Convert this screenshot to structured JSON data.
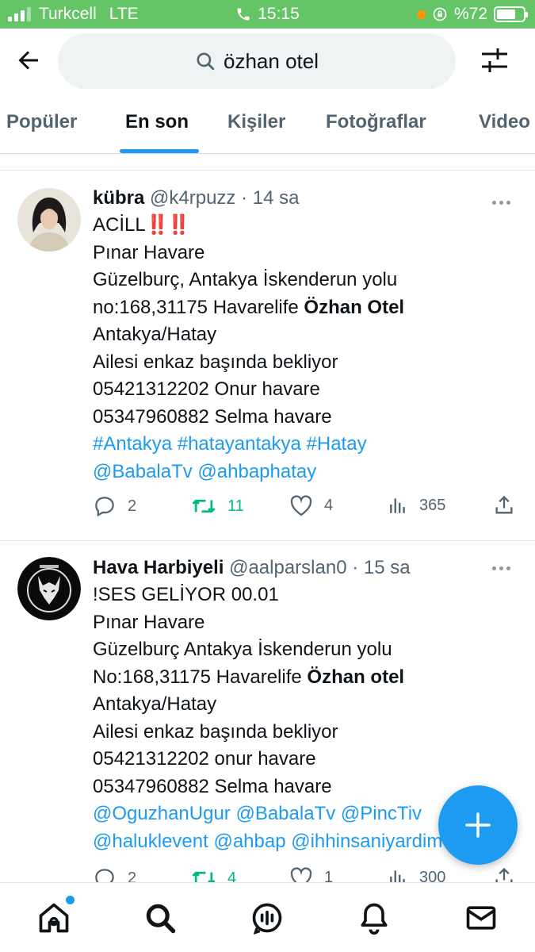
{
  "status_bar": {
    "carrier": "Turkcell",
    "network": "LTE",
    "time": "15:15",
    "battery": "%72",
    "battery_level": 0.72,
    "bg_color": "#65c466"
  },
  "header": {
    "back_icon": "arrow-left-icon",
    "search_query": "özhan otel",
    "filter_icon": "sliders-icon"
  },
  "tabs": [
    {
      "label": "Popüler",
      "active": false
    },
    {
      "label": "En son",
      "active": true
    },
    {
      "label": "Kişiler",
      "active": false
    },
    {
      "label": "Fotoğraflar",
      "active": false
    },
    {
      "label": "Video",
      "active": false
    }
  ],
  "tweets": [
    {
      "name": "kübra",
      "handle": "@k4rpuzz",
      "time": "· 14 sa",
      "lines": {
        "l1": "ACİLL",
        "l1_emoji": "‼️‼️",
        "l2": "Pınar Havare",
        "l3": "Güzelburç, Antakya İskenderun yolu",
        "l4a": "no:168,31175 Havarelife ",
        "l4b": "Özhan Otel",
        "l5": "Antakya/Hatay",
        "l6": "Ailesi enkaz başında bekliyor",
        "l7": "05421312202 Onur havare",
        "l8": "05347960882 Selma havare",
        "l9": " #Antakya #hatayantakya #Hatay",
        "l10": "@BabalaTv @ahbaphatay"
      },
      "replies": "2",
      "retweets": "11",
      "likes": "4",
      "views": "365"
    },
    {
      "name": "Hava Harbiyeli",
      "handle": "@aalparslan0",
      "time": "· 15 sa",
      "lines": {
        "l1": "!SES GELİYOR 00.01",
        "l2": "Pınar Havare",
        "l3": "Güzelburç Antakya İskenderun yolu",
        "l4a": "No:168,31175  Havarelife ",
        "l4b": "Özhan otel",
        "l5": "Antakya/Hatay",
        "l6": "Ailesi enkaz başında bekliyor",
        "l7": "05421312202 onur havare",
        "l8": "05347960882 Selma havare",
        "l9": "@OguzhanUgur @BabalaTv @PincTiv",
        "l10": "@haluklevent @ahbap @ihhinsaniyardim"
      },
      "replies": "2",
      "retweets": "4",
      "likes": "1",
      "views": "300"
    }
  ],
  "fab": {
    "icon": "plus-icon"
  },
  "bottom_nav": [
    {
      "icon": "home-icon",
      "has_dot": true
    },
    {
      "icon": "search-icon"
    },
    {
      "icon": "spaces-icon"
    },
    {
      "icon": "bell-icon"
    },
    {
      "icon": "mail-icon"
    }
  ],
  "colors": {
    "accent": "#1d9bf0",
    "retweet": "#00ba7c",
    "muted": "#536471"
  }
}
